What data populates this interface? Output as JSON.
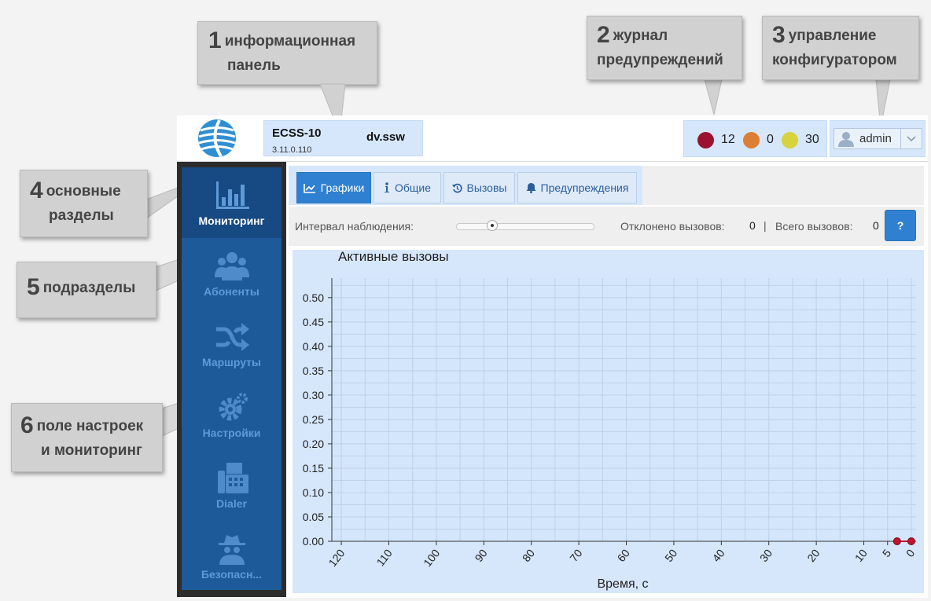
{
  "callouts": [
    {
      "number": "1",
      "line1": "информационная",
      "line2": "панель"
    },
    {
      "number": "2",
      "line1": "журнал",
      "line2": "предупреждений"
    },
    {
      "number": "3",
      "line1": "управление",
      "line2": "конфигуратором"
    },
    {
      "number": "4",
      "line1": "основные",
      "line2": "разделы"
    },
    {
      "number": "5",
      "line1": "подразделы",
      "line2": ""
    },
    {
      "number": "6",
      "line1": "поле настроек",
      "line2": "и мониторинг"
    }
  ],
  "header": {
    "product": "ECSS-10",
    "version": "3.11.0.110",
    "host": "dv.ssw",
    "alarms": [
      {
        "severity": "critical",
        "color": "#9b1230",
        "count": "12"
      },
      {
        "severity": "major",
        "color": "#dc7f35",
        "count": "0"
      },
      {
        "severity": "minor",
        "color": "#d6d33c",
        "count": "30"
      }
    ],
    "user": "admin"
  },
  "sidebar": {
    "items": [
      {
        "label": "Мониторинг",
        "icon": "bar-chart-icon",
        "active": true
      },
      {
        "label": "Абоненты",
        "icon": "users-icon",
        "active": false
      },
      {
        "label": "Маршруты",
        "icon": "shuffle-icon",
        "active": false
      },
      {
        "label": "Настройки",
        "icon": "gears-icon",
        "active": false
      },
      {
        "label": "Dialer",
        "icon": "fax-icon",
        "active": false
      },
      {
        "label": "Безопасн...",
        "icon": "spy-icon",
        "active": false
      }
    ]
  },
  "tabs": [
    {
      "label": "Графики",
      "icon": "line-chart-icon",
      "active": true
    },
    {
      "label": "Общие",
      "icon": "info-icon",
      "active": false
    },
    {
      "label": "Вызовы",
      "icon": "history-icon",
      "active": false
    },
    {
      "label": "Предупреждения",
      "icon": "bell-icon",
      "active": false
    }
  ],
  "filter": {
    "interval_label": "Интервал наблюдения:",
    "rejected_label": "Отклонено вызовов:",
    "rejected_value": "0",
    "separator": "|",
    "total_label": "Всего вызовов:",
    "total_value": "0",
    "help_label": "?"
  },
  "chart_data": {
    "type": "line",
    "title": "Активные вызовы",
    "xlabel": "Время, с",
    "ylabel": "",
    "xlim": [
      122,
      -1
    ],
    "ylim": [
      0,
      0.54
    ],
    "x_ticks": [
      120,
      110,
      100,
      90,
      80,
      70,
      60,
      50,
      40,
      30,
      20,
      10,
      5,
      0
    ],
    "y_ticks": [
      "0.00",
      "0.05",
      "0.10",
      "0.15",
      "0.20",
      "0.25",
      "0.30",
      "0.35",
      "0.40",
      "0.45",
      "0.50"
    ],
    "grid": true,
    "series": [
      {
        "color": "#c0142e",
        "x": [
          3,
          0
        ],
        "y": [
          0,
          0
        ]
      }
    ]
  }
}
